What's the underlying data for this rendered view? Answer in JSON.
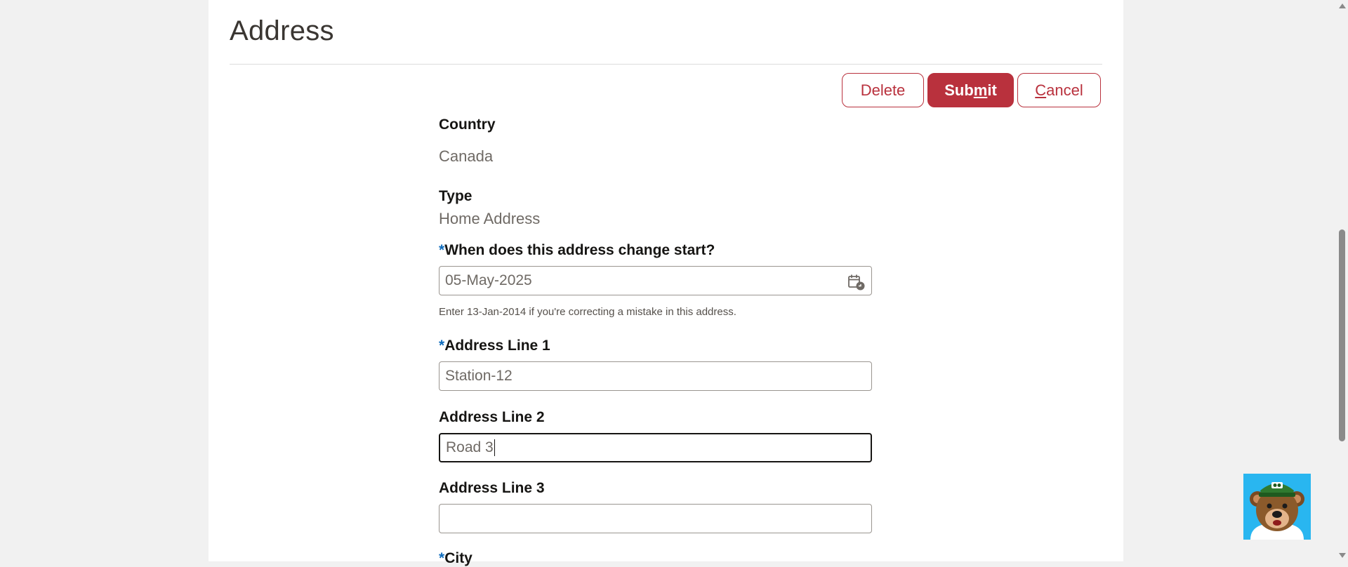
{
  "page": {
    "title": "Address"
  },
  "actions": {
    "delete_label": "Delete",
    "submit_pre": "Sub",
    "submit_u": "m",
    "submit_post": "it",
    "cancel_u": "C",
    "cancel_post": "ancel"
  },
  "form": {
    "country": {
      "label": "Country",
      "value": "Canada"
    },
    "type": {
      "label": "Type",
      "value": "Home Address"
    },
    "start_date": {
      "required_mark": "*",
      "label": "When does this address change start?",
      "value": "05-May-2025",
      "help": "Enter 13-Jan-2014 if you're correcting a mistake in this address."
    },
    "address_line_1": {
      "required_mark": "*",
      "label": "Address Line 1",
      "value": "Station-12"
    },
    "address_line_2": {
      "label": "Address Line 2",
      "value": "Road 3"
    },
    "address_line_3": {
      "label": "Address Line 3",
      "value": ""
    },
    "city": {
      "required_mark": "*",
      "label": "City"
    }
  },
  "icons": {
    "calendar": "calendar-icon",
    "mascot": "bear-mascot-icon"
  },
  "colors": {
    "brand": "#b9313d",
    "required": "#0f6cbd",
    "mascot_bg": "#29b6f0"
  }
}
